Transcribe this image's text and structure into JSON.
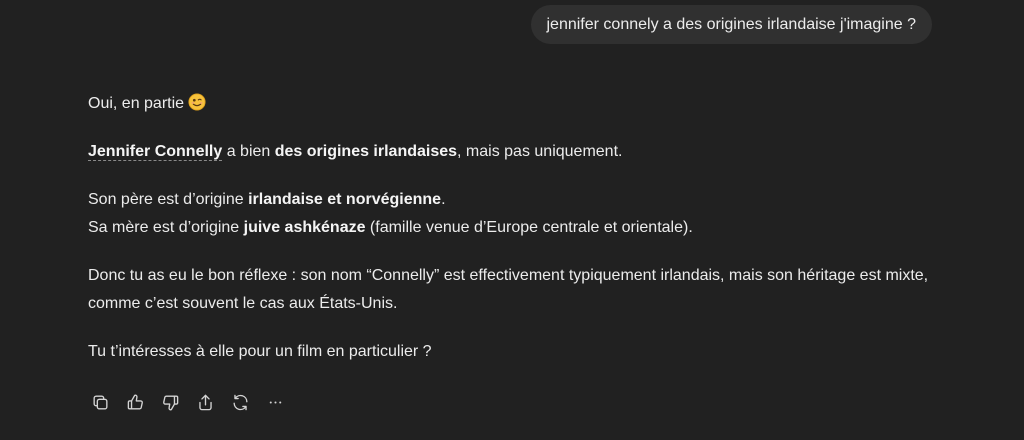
{
  "user_message": "jennifer connely a des origines irlandaise j'imagine ?",
  "assistant": {
    "p1": {
      "text": "Oui, en partie",
      "emoji": "slightly-smiling-face"
    },
    "p2": {
      "entity": "Jennifer Connelly",
      "t1": " a bien ",
      "b1": "des origines irlandaises",
      "t2": ", mais pas uniquement."
    },
    "p3": {
      "line1_t1": "Son père est d’origine ",
      "line1_b1": "irlandaise et norvégienne",
      "line1_t2": ".",
      "line2_t1": "Sa mère est d’origine ",
      "line2_b1": "juive ashkénaze",
      "line2_t2": " (famille venue d’Europe centrale et orientale)."
    },
    "p4": "Donc tu as eu le bon réflexe : son nom “Connelly” est effectivement typiquement irlandais, mais son héritage est mixte, comme c’est souvent le cas aux États-Unis.",
    "p5": "Tu t’intéresses à elle pour un film en particulier ?"
  },
  "actions": {
    "icons": [
      "copy-icon",
      "thumbs-up-icon",
      "thumbs-down-icon",
      "share-icon",
      "regenerate-icon",
      "more-icon"
    ]
  },
  "colors": {
    "background": "#212121",
    "bubble": "#303030",
    "text": "#ececec"
  }
}
